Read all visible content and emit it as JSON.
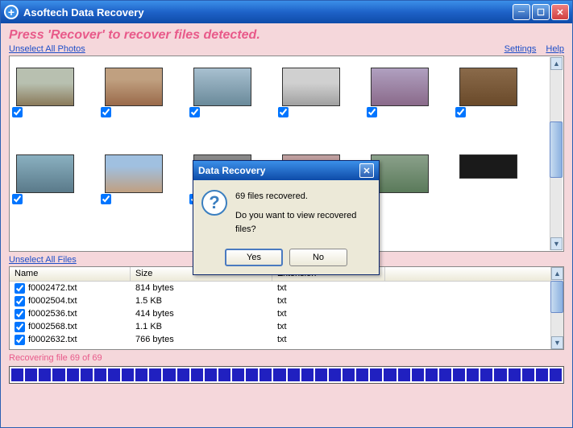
{
  "titlebar": {
    "title": "Asoftech Data Recovery"
  },
  "instruction": "Press 'Recover' to recover files detected.",
  "links": {
    "unselect_photos": "Unselect All Photos",
    "unselect_files": "Unselect All Files",
    "settings": "Settings",
    "help": "Help"
  },
  "files": {
    "headers": {
      "name": "Name",
      "size": "Size",
      "ext": "Extension"
    },
    "rows": [
      {
        "name": "f0002472.txt",
        "size": "814 bytes",
        "ext": "txt"
      },
      {
        "name": "f0002504.txt",
        "size": "1.5 KB",
        "ext": "txt"
      },
      {
        "name": "f0002536.txt",
        "size": "414 bytes",
        "ext": "txt"
      },
      {
        "name": "f0002568.txt",
        "size": "1.1 KB",
        "ext": "txt"
      },
      {
        "name": "f0002632.txt",
        "size": "766 bytes",
        "ext": "txt"
      }
    ]
  },
  "status": "Recovering file 69 of 69",
  "dialog": {
    "title": "Data Recovery",
    "line1": "69 files recovered.",
    "line2": "Do you want to view recovered files?",
    "yes": "Yes",
    "no": "No"
  }
}
